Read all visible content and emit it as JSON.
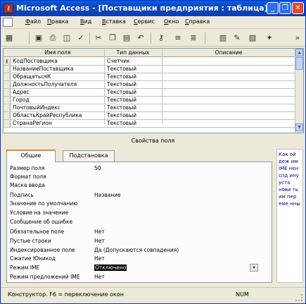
{
  "window": {
    "title": "Microsoft Access - [Поставщики предприятия : таблица]",
    "app_icon": "access-key-icon",
    "controls": [
      "_",
      "❐",
      "✕"
    ]
  },
  "menu": {
    "items": [
      "Файл",
      "Правка",
      "Вид",
      "Вставка",
      "Сервис",
      "Окно",
      "Справка"
    ]
  },
  "toolbar": {
    "icons": [
      "view-icon",
      "save-icon",
      "print-icon",
      "print-preview-icon",
      "spelling-icon",
      "cut-icon",
      "copy-icon",
      "paste-icon",
      "undo-icon",
      "key-icon",
      "insert-rows-icon",
      "delete-rows-icon",
      "properties-icon",
      "build-icon",
      "database-window-icon",
      "new-object-icon"
    ]
  },
  "design_grid": {
    "headers": [
      "Имя поля",
      "Тип данных",
      "Описание"
    ],
    "rows": [
      {
        "name": "КодПоставщика",
        "type": "Счетчик",
        "key": true
      },
      {
        "name": "НазваниеПоставщика",
        "type": "Текстовый"
      },
      {
        "name": "ОбращатьсяК",
        "type": "Текстовый"
      },
      {
        "name": "ДолжностьПолучателя",
        "type": "Текстовый"
      },
      {
        "name": "Адрес",
        "type": "Текстовый"
      },
      {
        "name": "Город",
        "type": "Текстовый"
      },
      {
        "name": "ПочтовыйИндекс",
        "type": "Текстовый"
      },
      {
        "name": "ОбластьКрайРеспублика",
        "type": "Текстовый"
      },
      {
        "name": "СтранаРегион",
        "type": "Текстовый"
      }
    ]
  },
  "properties": {
    "label": "Свойства поля",
    "tabs": [
      "Общие",
      "Подстановка"
    ],
    "rows": [
      {
        "label": "Размер поля",
        "value": "50"
      },
      {
        "label": "Формат поля",
        "value": ""
      },
      {
        "label": "Маска ввода",
        "value": ""
      },
      {
        "label": "Подпись",
        "value": "Название"
      },
      {
        "label": "Значение по умолчанию",
        "value": ""
      },
      {
        "label": "Условие на значение",
        "value": ""
      },
      {
        "label": "Сообщение об ошибке",
        "value": ""
      },
      {
        "label": "Обязательное поле",
        "value": "Нет"
      },
      {
        "label": "Пустые строки",
        "value": "Нет"
      },
      {
        "label": "Индексированное поле",
        "value": "Да (Допускаются совпадения)"
      },
      {
        "label": "Сжатие Юникод",
        "value": "Нет"
      },
      {
        "label": "Режим IME",
        "value": "Отключено",
        "selected": true
      },
      {
        "label": "Режим предложений IME",
        "value": "Нет"
      }
    ],
    "help_text": "Как ой деж им IME нен спд ину уста нови ть им пер еме нны"
  },
  "status": {
    "text": "Конструктор.  F6 = переключение окон",
    "num": "NUM"
  }
}
